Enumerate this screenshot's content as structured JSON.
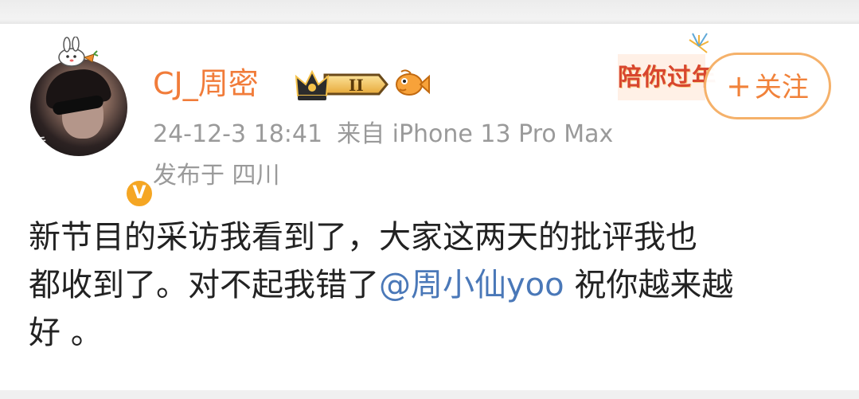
{
  "user": {
    "name": "CJ_周密",
    "vip_level": "II",
    "verified_mark": "V"
  },
  "meta": {
    "time": "24-12-3 18:41",
    "source": "来自 iPhone 13 Pro Max",
    "location": "发布于 四川"
  },
  "promo": {
    "text": "陪你过年"
  },
  "follow_button": {
    "plus": "+",
    "label": "关注"
  },
  "post": {
    "line1": "新节目的采访我看到了，大家这两天的批评我也",
    "line2_pre": "都收到了。对不起我错了",
    "mention": "@周小仙yoo",
    "line2_post": " 祝你越来越",
    "line3": "好 。"
  },
  "colors": {
    "username": "#f17c3a",
    "meta": "#9a9a9a",
    "mention": "#4a78b8",
    "follow_border": "#f5b16a",
    "verified": "#f5a623"
  },
  "icons": [
    "crown-vip-icon",
    "fish-icon",
    "verified-icon",
    "bunny-icon"
  ]
}
